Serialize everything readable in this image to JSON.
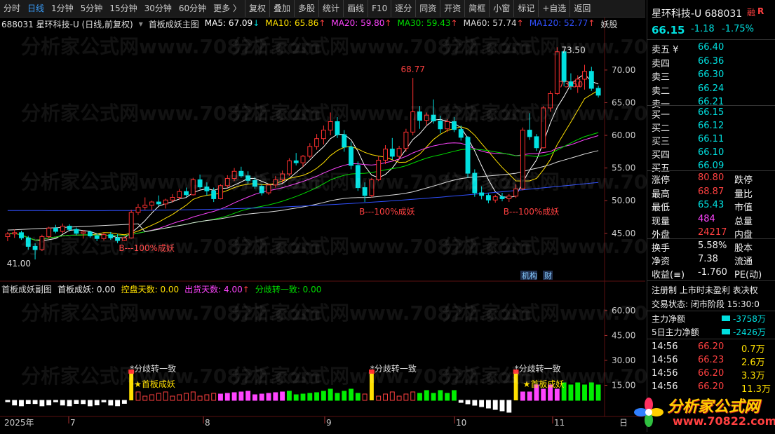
{
  "toolbar": {
    "items": [
      "分时",
      "日线",
      "1分钟",
      "5分钟",
      "15分钟",
      "30分钟",
      "60分钟",
      "更多 〉",
      "复权",
      "叠加",
      "多股",
      "统计",
      "画线",
      "F10",
      "逐分",
      "同资",
      "开资",
      "简框",
      "小窗",
      "标记",
      "+自选",
      "返回"
    ],
    "active_index": 1
  },
  "main_legend": {
    "stock": "688031 星环科技-U (日线,前复权)",
    "indicator": "首板成妖主图",
    "ma": [
      {
        "text": "MA5: 67.09",
        "color": "#ffffff",
        "arrow": "↓"
      },
      {
        "text": "MA10: 65.86",
        "color": "#ffe000",
        "arrow": "↑"
      },
      {
        "text": "MA20: 59.80",
        "color": "#ff44ff",
        "arrow": "↑"
      },
      {
        "text": "MA30: 59.43",
        "color": "#00dd00",
        "arrow": "↑"
      },
      {
        "text": "MA60: 57.74",
        "color": "#dddddd",
        "arrow": "↑"
      },
      {
        "text": "MA120: 52.77",
        "color": "#3050ff",
        "arrow": "↑"
      }
    ],
    "yaogu": "妖股"
  },
  "sub_legend": {
    "title": "首板成妖副图",
    "items": [
      {
        "text": "首板成妖: 0.00",
        "color": "#eeeeee"
      },
      {
        "text": "控盘天数: 0.00",
        "color": "#ffe000"
      },
      {
        "text": "出货天数: 4.00",
        "color": "#ff44ff",
        "arrow": "↑"
      },
      {
        "text": "分歧转一致: 0.00",
        "color": "#00dd00"
      }
    ]
  },
  "watermark": "分析家公式网www.70822.com",
  "chart_data": [
    {
      "type": "candlestick",
      "y_axis_ticks": [
        "70.00",
        "65.00",
        "60.00",
        "55.00",
        "50.00",
        "45.00"
      ],
      "ylim": [
        38,
        76
      ],
      "x_axis_labels": [
        "2025年",
        "7",
        "8",
        "9",
        "10",
        "11",
        "日"
      ],
      "annotations": [
        "41.00",
        "68.77",
        "73.50",
        "73.50",
        "B---100%成妖",
        "B---100%成妖",
        "B---100%成妖"
      ],
      "overlay_labels": [
        "机构",
        "财"
      ],
      "ohlc": [
        [
          44.5,
          45.2,
          43.8,
          44.9
        ],
        [
          44.9,
          45.6,
          44.3,
          45.1
        ],
        [
          45.1,
          45.4,
          44.0,
          44.3
        ],
        [
          44.3,
          44.6,
          42.5,
          43.0
        ],
        [
          43.0,
          43.5,
          41.0,
          42.5
        ],
        [
          42.5,
          44.8,
          42.3,
          44.5
        ],
        [
          44.5,
          46.0,
          44.2,
          45.8
        ],
        [
          45.8,
          46.3,
          45.0,
          45.3
        ],
        [
          45.3,
          46.5,
          45.0,
          46.1
        ],
        [
          46.1,
          46.4,
          45.3,
          45.6
        ],
        [
          45.6,
          45.9,
          44.7,
          45.0
        ],
        [
          45.0,
          45.5,
          44.2,
          45.2
        ],
        [
          45.2,
          45.4,
          44.3,
          44.6
        ],
        [
          44.6,
          45.0,
          43.8,
          44.2
        ],
        [
          44.2,
          45.1,
          43.9,
          44.8
        ],
        [
          44.8,
          45.2,
          44.0,
          44.3
        ],
        [
          44.3,
          44.9,
          43.5,
          43.9
        ],
        [
          43.9,
          44.5,
          43.8,
          44.3
        ],
        [
          44.3,
          48.6,
          44.2,
          48.2
        ],
        [
          48.2,
          49.5,
          47.8,
          49.0
        ],
        [
          49.0,
          50.5,
          48.6,
          49.3
        ],
        [
          49.3,
          50.0,
          48.5,
          49.8
        ],
        [
          49.8,
          50.8,
          49.2,
          49.5
        ],
        [
          49.5,
          50.3,
          48.8,
          50.1
        ],
        [
          50.1,
          51.0,
          49.7,
          50.5
        ],
        [
          50.5,
          51.8,
          50.1,
          51.4
        ],
        [
          51.4,
          52.0,
          50.6,
          50.9
        ],
        [
          50.9,
          53.5,
          50.8,
          53.2
        ],
        [
          53.2,
          54.0,
          51.8,
          52.1
        ],
        [
          52.1,
          52.8,
          50.8,
          51.5
        ],
        [
          51.5,
          52.0,
          49.8,
          50.3
        ],
        [
          50.3,
          52.5,
          50.2,
          52.3
        ],
        [
          52.3,
          53.9,
          52.0,
          53.4
        ],
        [
          53.4,
          55.0,
          53.0,
          54.5
        ],
        [
          54.5,
          55.2,
          53.5,
          53.8
        ],
        [
          53.8,
          54.5,
          52.6,
          53.1
        ],
        [
          53.1,
          53.6,
          51.8,
          52.2
        ],
        [
          52.2,
          52.5,
          50.8,
          51.2
        ],
        [
          51.2,
          52.6,
          50.9,
          52.4
        ],
        [
          52.4,
          53.8,
          52.0,
          53.2
        ],
        [
          53.2,
          54.6,
          52.7,
          54.1
        ],
        [
          54.1,
          56.5,
          53.8,
          56.1
        ],
        [
          56.1,
          57.3,
          55.4,
          55.8
        ],
        [
          55.8,
          57.0,
          55.2,
          56.8
        ],
        [
          56.8,
          58.8,
          56.5,
          58.3
        ],
        [
          58.3,
          60.2,
          57.8,
          59.5
        ],
        [
          59.5,
          61.5,
          58.6,
          60.8
        ],
        [
          60.8,
          63.5,
          60.0,
          62.1
        ],
        [
          62.1,
          62.8,
          59.6,
          60.1
        ],
        [
          60.1,
          60.8,
          57.5,
          58.2
        ],
        [
          58.2,
          59.0,
          54.8,
          55.4
        ],
        [
          55.4,
          56.0,
          51.5,
          52.0
        ],
        [
          52.0,
          52.8,
          49.8,
          50.8
        ],
        [
          50.8,
          53.5,
          50.5,
          53.2
        ],
        [
          53.2,
          56.8,
          53.0,
          56.2
        ],
        [
          56.2,
          58.5,
          55.6,
          57.9
        ],
        [
          57.9,
          59.6,
          56.3,
          56.8
        ],
        [
          56.8,
          58.4,
          56.2,
          58.0
        ],
        [
          58.0,
          61.0,
          57.5,
          60.5
        ],
        [
          60.5,
          68.8,
          60.0,
          63.6
        ],
        [
          63.6,
          64.5,
          61.0,
          62.3
        ],
        [
          62.3,
          63.5,
          61.5,
          63.1
        ],
        [
          63.1,
          65.5,
          61.8,
          62.2
        ],
        [
          62.2,
          63.0,
          60.3,
          61.0
        ],
        [
          61.0,
          62.5,
          60.5,
          62.1
        ],
        [
          62.1,
          62.8,
          60.5,
          60.9
        ],
        [
          60.9,
          61.5,
          59.2,
          59.7
        ],
        [
          59.7,
          59.9,
          53.5,
          54.2
        ],
        [
          54.2,
          54.8,
          50.6,
          51.2
        ],
        [
          51.2,
          52.2,
          50.2,
          50.8
        ],
        [
          50.8,
          51.1,
          49.6,
          50.1
        ],
        [
          50.1,
          50.9,
          49.7,
          50.6
        ],
        [
          50.6,
          51.2,
          49.9,
          50.3
        ],
        [
          50.3,
          51.0,
          49.8,
          50.7
        ],
        [
          50.7,
          52.5,
          50.4,
          51.8
        ],
        [
          51.8,
          61.2,
          51.6,
          60.8
        ],
        [
          60.8,
          63.4,
          59.3,
          59.8
        ],
        [
          59.8,
          60.2,
          57.6,
          58.1
        ],
        [
          58.1,
          64.5,
          58.0,
          64.2
        ],
        [
          64.2,
          66.8,
          63.6,
          66.4
        ],
        [
          66.4,
          73.5,
          66.2,
          72.8
        ],
        [
          72.8,
          73.0,
          67.5,
          68.2
        ],
        [
          68.2,
          69.5,
          67.0,
          67.5
        ],
        [
          67.5,
          69.2,
          66.5,
          68.6
        ],
        [
          68.6,
          70.8,
          67.0,
          69.8
        ],
        [
          69.8,
          70.5,
          66.8,
          67.2
        ],
        [
          67.2,
          67.6,
          65.8,
          66.15
        ]
      ]
    },
    {
      "type": "bar",
      "y_axis_ticks": [
        "60.00",
        "45.00",
        "30.00",
        "15.00"
      ],
      "ylim": [
        0,
        68
      ],
      "annotations": [
        "*分歧转一致",
        "*分歧转一致",
        "*分歧转一致",
        "★首板成妖",
        "★首板成妖"
      ]
    }
  ],
  "quote": {
    "name": "星环科技-U 688031",
    "badge1": "融",
    "badge2": "R",
    "price": "66.15",
    "change": "-1.18",
    "change_pct": "-1.75%",
    "sell": [
      {
        "label": "卖五 ¥",
        "price": "66.40"
      },
      {
        "label": "卖四",
        "price": "66.36"
      },
      {
        "label": "卖三",
        "price": "66.30"
      },
      {
        "label": "卖二",
        "price": "66.24"
      },
      {
        "label": "卖一",
        "price": "66.21"
      }
    ],
    "buy": [
      {
        "label": "买一",
        "price": "66.15"
      },
      {
        "label": "买二",
        "price": "66.12"
      },
      {
        "label": "买三",
        "price": "66.11"
      },
      {
        "label": "买四",
        "price": "66.10"
      },
      {
        "label": "买五",
        "price": "66.09"
      }
    ],
    "stats": [
      {
        "label": "涨停",
        "value": "80.80",
        "color": "red",
        "label2": "跌停"
      },
      {
        "label": "最高",
        "value": "68.87",
        "color": "red",
        "label2": "量比"
      },
      {
        "label": "最低",
        "value": "65.43",
        "color": "green",
        "label2": "市值"
      },
      {
        "label": "现量",
        "value": "484",
        "color": "mag",
        "label2": "总量"
      },
      {
        "label": "外盘",
        "value": "24217",
        "color": "red",
        "label2": "内盘"
      }
    ],
    "stats2": [
      {
        "label": "换手",
        "value": "5.58%",
        "label2": "股本"
      },
      {
        "label": "净资",
        "value": "7.38",
        "label2": "流通"
      },
      {
        "label": "收益(≡)",
        "value": "-1.760",
        "label2": "PE(动)"
      }
    ],
    "tags": "注册制 上市时未盈利 表决权",
    "trade_status": "交易状态: 闭市阶段 15:30:0",
    "flow": [
      {
        "label": "主力净额",
        "value": "-3758万"
      },
      {
        "label": "5日主力净额",
        "value": "-2426万"
      }
    ],
    "ticks": [
      {
        "time": "14:56",
        "price": "66.20",
        "vol": "0.7万"
      },
      {
        "time": "14:56",
        "price": "66.23",
        "vol": "2.6万"
      },
      {
        "time": "14:56",
        "price": "66.20",
        "vol": "3.3万"
      },
      {
        "time": "14:56",
        "price": "66.20",
        "vol": "11.3万"
      }
    ],
    "logo_text": "分析家公式网",
    "logo_url": "www.70822.com"
  }
}
